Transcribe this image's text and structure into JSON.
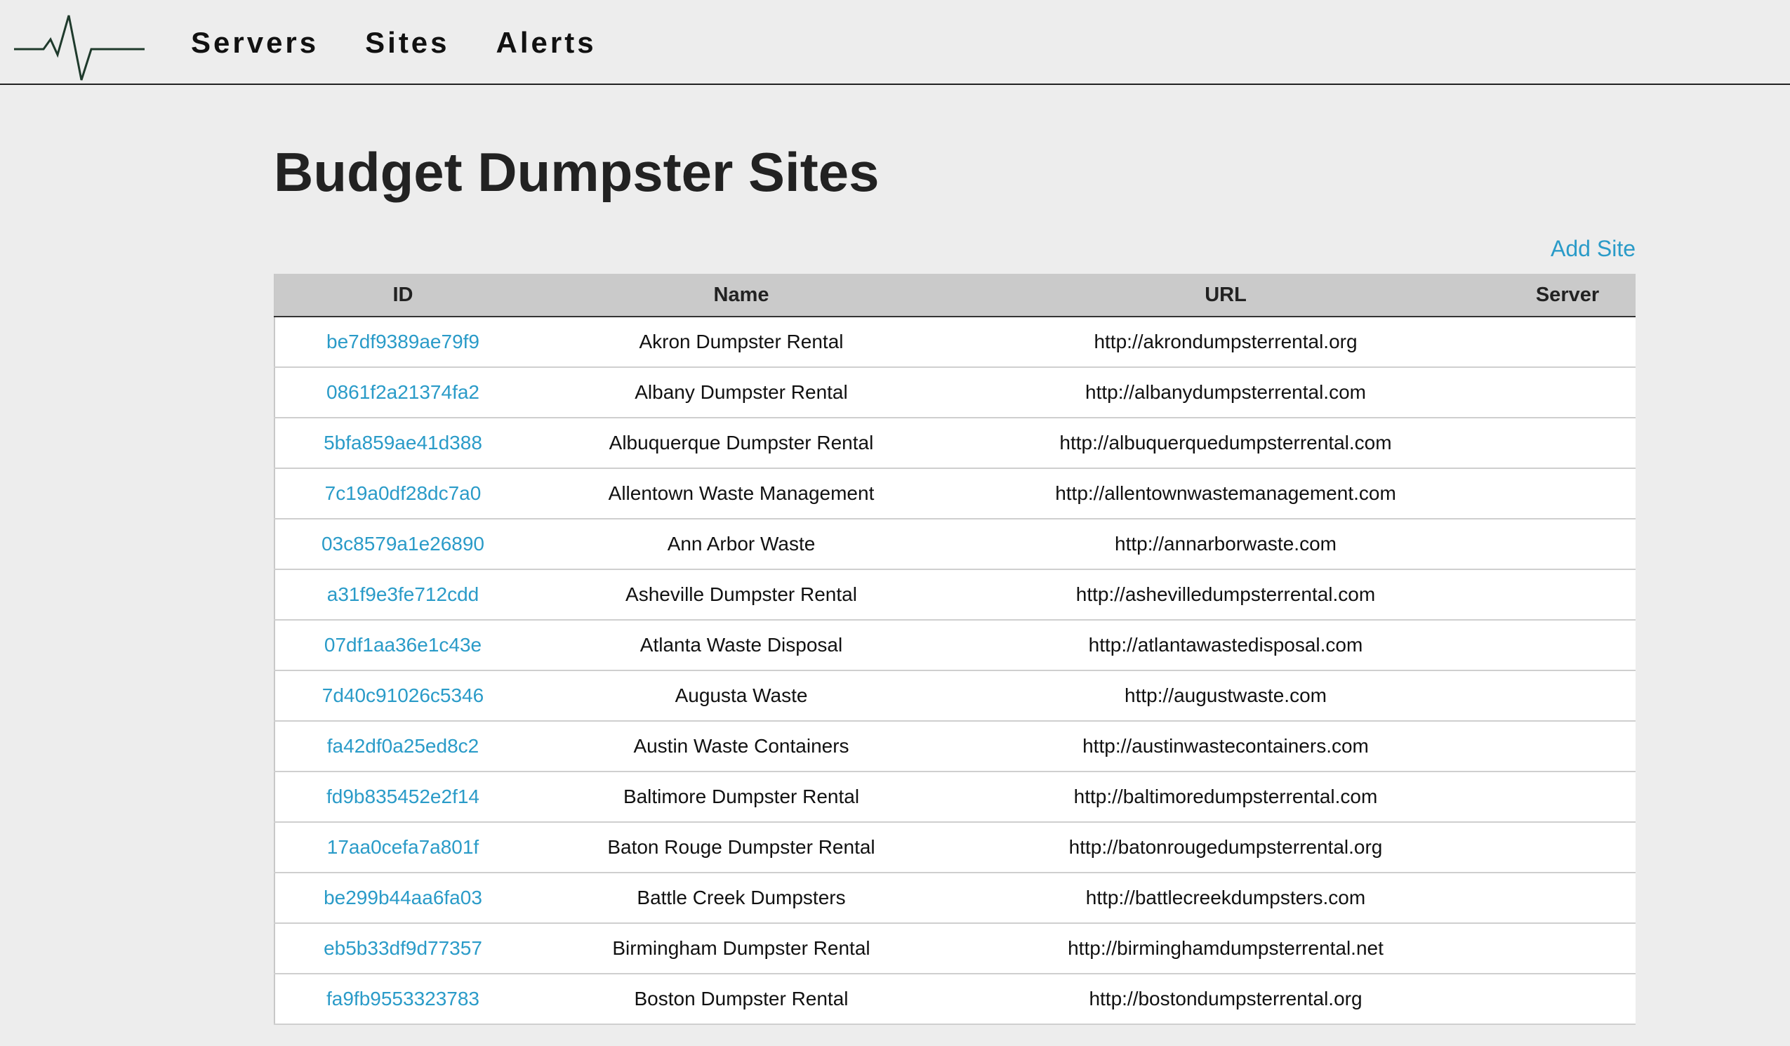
{
  "nav": {
    "logo_icon": "heartbeat-pulse-icon",
    "items": [
      {
        "label": "Servers"
      },
      {
        "label": "Sites"
      },
      {
        "label": "Alerts"
      }
    ]
  },
  "page": {
    "title": "Budget Dumpster Sites",
    "add_site_label": "Add Site"
  },
  "colors": {
    "link": "#2a9bc8",
    "header_bg": "#cacaca",
    "page_bg": "#ededed"
  },
  "table": {
    "headers": {
      "id": "ID",
      "name": "Name",
      "url": "URL",
      "server": "Server"
    },
    "rows": [
      {
        "id": "be7df9389ae79f9",
        "name": "Akron Dumpster Rental",
        "url": "http://akrondumpsterrental.org",
        "server": ""
      },
      {
        "id": "0861f2a21374fa2",
        "name": "Albany Dumpster Rental",
        "url": "http://albanydumpsterrental.com",
        "server": ""
      },
      {
        "id": "5bfa859ae41d388",
        "name": "Albuquerque Dumpster Rental",
        "url": "http://albuquerquedumpsterrental.com",
        "server": ""
      },
      {
        "id": "7c19a0df28dc7a0",
        "name": "Allentown Waste Management",
        "url": "http://allentownwastemanagement.com",
        "server": ""
      },
      {
        "id": "03c8579a1e26890",
        "name": "Ann Arbor Waste",
        "url": "http://annarborwaste.com",
        "server": ""
      },
      {
        "id": "a31f9e3fe712cdd",
        "name": "Asheville Dumpster Rental",
        "url": "http://ashevilledumpsterrental.com",
        "server": ""
      },
      {
        "id": "07df1aa36e1c43e",
        "name": "Atlanta Waste Disposal",
        "url": "http://atlantawastedisposal.com",
        "server": ""
      },
      {
        "id": "7d40c91026c5346",
        "name": "Augusta Waste",
        "url": "http://augustwaste.com",
        "server": ""
      },
      {
        "id": "fa42df0a25ed8c2",
        "name": "Austin Waste Containers",
        "url": "http://austinwastecontainers.com",
        "server": ""
      },
      {
        "id": "fd9b835452e2f14",
        "name": "Baltimore Dumpster Rental",
        "url": "http://baltimoredumpsterrental.com",
        "server": ""
      },
      {
        "id": "17aa0cefa7a801f",
        "name": "Baton Rouge Dumpster Rental",
        "url": "http://batonrougedumpsterrental.org",
        "server": ""
      },
      {
        "id": "be299b44aa6fa03",
        "name": "Battle Creek Dumpsters",
        "url": "http://battlecreekdumpsters.com",
        "server": ""
      },
      {
        "id": "eb5b33df9d77357",
        "name": "Birmingham Dumpster Rental",
        "url": "http://birminghamdumpsterrental.net",
        "server": ""
      },
      {
        "id": "fa9fb9553323783",
        "name": "Boston Dumpster Rental",
        "url": "http://bostondumpsterrental.org",
        "server": ""
      }
    ]
  }
}
